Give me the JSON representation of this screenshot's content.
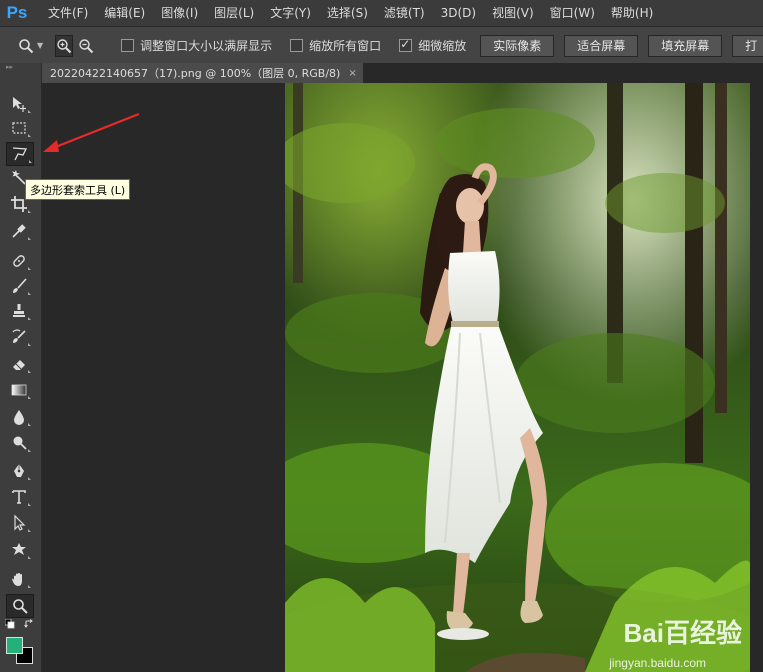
{
  "app": {
    "logo": "Ps"
  },
  "menu": [
    "文件(F)",
    "编辑(E)",
    "图像(I)",
    "图层(L)",
    "文字(Y)",
    "选择(S)",
    "滤镜(T)",
    "3D(D)",
    "视图(V)",
    "窗口(W)",
    "帮助(H)"
  ],
  "options": {
    "resize_windows": {
      "label": "调整窗口大小以满屏显示",
      "checked": false
    },
    "zoom_all": {
      "label": "缩放所有窗口",
      "checked": false
    },
    "scrubby": {
      "label": "细微缩放",
      "checked": true
    },
    "buttons": [
      "实际像素",
      "适合屏幕",
      "填充屏幕",
      "打"
    ]
  },
  "document_tab": {
    "title": "20220422140657（17).png @ 100%（图层 0, RGB/8)",
    "close": "×"
  },
  "tooltip": {
    "text": "多边形套索工具 (L)"
  },
  "colors": {
    "foreground": "#23b07a",
    "background": "#000000",
    "annotation_arrow": "#e52a2a"
  },
  "watermark": {
    "main": "Bai百经验",
    "sub": "jingyan.baidu.com"
  },
  "tools": [
    "move-icon",
    "marquee-icon",
    "polygonal-lasso-icon",
    "magic-wand-icon",
    "crop-icon",
    "eyedropper-icon",
    "healing-brush-icon",
    "brush-icon",
    "clone-stamp-icon",
    "history-brush-icon",
    "eraser-icon",
    "gradient-icon",
    "blur-icon",
    "dodge-icon",
    "pen-icon",
    "type-icon",
    "path-selection-icon",
    "custom-shape-icon",
    "hand-icon",
    "zoom-icon"
  ]
}
